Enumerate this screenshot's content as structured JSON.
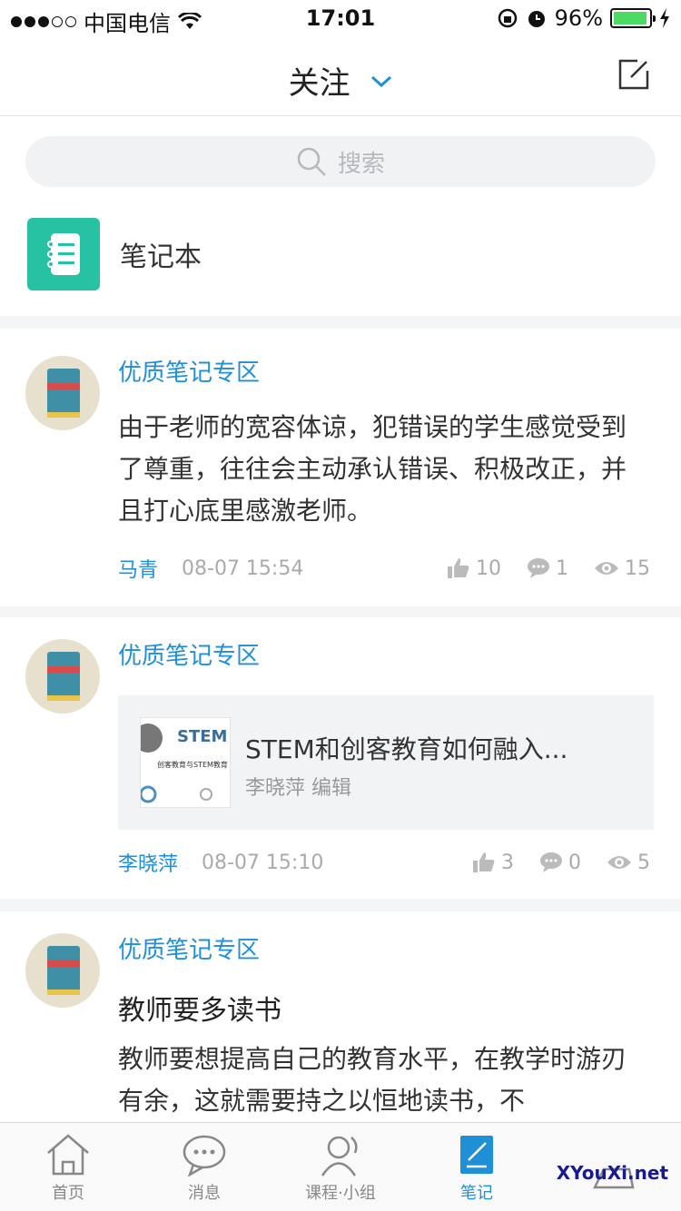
{
  "status": {
    "carrier": "中国电信",
    "time": "17:01",
    "battery": "96%",
    "battery_level": 0.96
  },
  "nav": {
    "title": "关注"
  },
  "search": {
    "placeholder": "搜索"
  },
  "notebook": {
    "label": "笔记本"
  },
  "posts": [
    {
      "category": "优质笔记专区",
      "body": "由于老师的宽容体谅，犯错误的学生感觉受到了尊重，往往会主动承认错误、积极改正，并且打心底里感激老师。",
      "author": "马青",
      "time": "08-07 15:54",
      "likes": "10",
      "comments": "1",
      "views": "15"
    },
    {
      "category": "优质笔记专区",
      "article_title": "STEM和创客教育如何融入...",
      "article_sub": "李晓萍 编辑",
      "thumb_text": "STEM",
      "thumb_caption": "创客教育与STEM教育",
      "author": "李晓萍",
      "time": "08-07 15:10",
      "likes": "3",
      "comments": "0",
      "views": "5"
    },
    {
      "category": "优质笔记专区",
      "title": "教师要多读书",
      "body": "教师要想提高自己的教育水平，在教学时游刃有余，这就需要持之以恒地读书，不"
    }
  ],
  "tabs": [
    {
      "label": "首页",
      "icon": "home-icon"
    },
    {
      "label": "消息",
      "icon": "message-icon"
    },
    {
      "label": "课程·小组",
      "icon": "person-icon"
    },
    {
      "label": "笔记",
      "icon": "note-icon"
    },
    {
      "label": "",
      "icon": "tray-icon"
    }
  ],
  "watermark": "XYouXi.net",
  "colors": {
    "accent": "#1f8fd6",
    "notebook": "#26c2a3",
    "battery": "#4cd964"
  }
}
